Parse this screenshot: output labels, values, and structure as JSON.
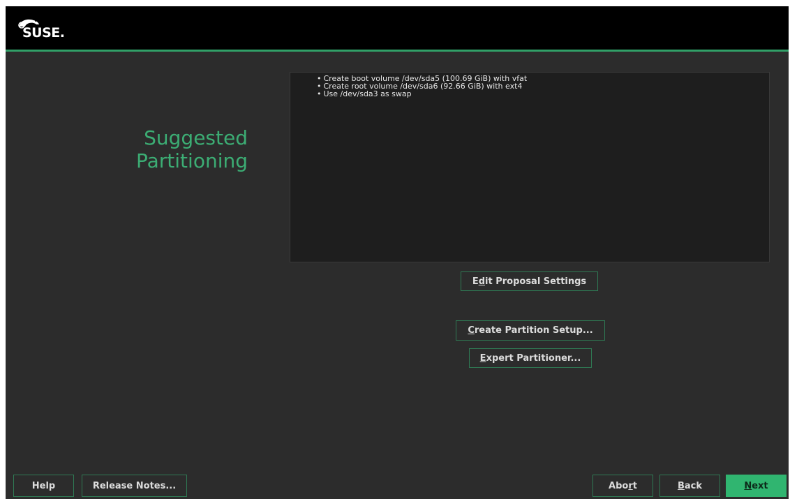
{
  "header": {
    "brand_name": "SUSE.",
    "logo_icon": "chameleon-icon",
    "accent_color": "#31a068"
  },
  "main": {
    "title_line1": "Suggested",
    "title_line2": "Partitioning",
    "summary": [
      "Create boot volume /dev/sda5 (100.69 GiB) with vfat",
      "Create root volume /dev/sda6 (92.66 GiB) with ext4",
      "Use /dev/sda3 as swap"
    ]
  },
  "buttons": {
    "edit_proposal": {
      "pre": "E",
      "mn": "d",
      "post": "it Proposal Settings"
    },
    "create_partition": {
      "pre": "",
      "mn": "C",
      "post": "reate Partition Setup..."
    },
    "expert_partitioner": {
      "pre": "",
      "mn": "E",
      "post": "xpert Partitioner..."
    }
  },
  "footer": {
    "help": "Help",
    "release_notes": "Release Notes...",
    "abort": {
      "pre": "Abo",
      "mn": "r",
      "post": "t"
    },
    "back": {
      "pre": "",
      "mn": "B",
      "post": "ack"
    },
    "next": {
      "pre": "",
      "mn": "N",
      "post": "ext"
    },
    "next_color": "#30b570"
  }
}
